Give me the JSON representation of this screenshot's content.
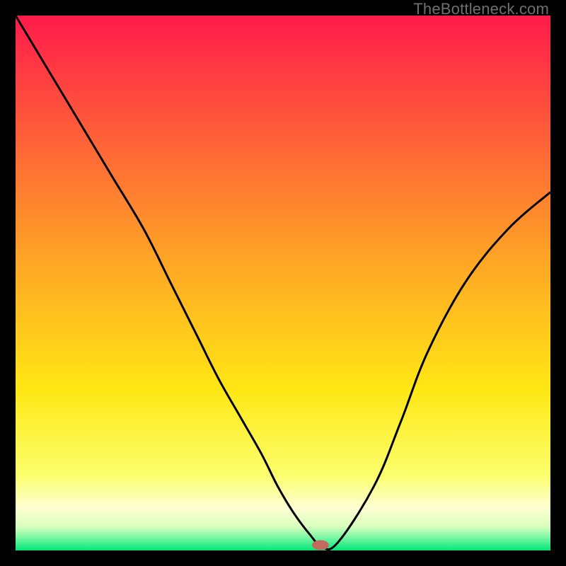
{
  "watermark": "TheBottleneck.com",
  "chart_data": {
    "type": "line",
    "title": "",
    "xlabel": "",
    "ylabel": "",
    "xlim": [
      0,
      100
    ],
    "ylim": [
      0,
      100
    ],
    "grid": false,
    "background_gradient": {
      "stops": [
        {
          "offset": 0.0,
          "color": "#ff1b4b"
        },
        {
          "offset": 0.45,
          "color": "#ffa326"
        },
        {
          "offset": 0.7,
          "color": "#ffe714"
        },
        {
          "offset": 0.86,
          "color": "#fbff6d"
        },
        {
          "offset": 0.92,
          "color": "#feffd2"
        },
        {
          "offset": 0.955,
          "color": "#d9ffbe"
        },
        {
          "offset": 0.975,
          "color": "#7ef7a5"
        },
        {
          "offset": 1.0,
          "color": "#00e778"
        }
      ]
    },
    "series": [
      {
        "name": "bottleneck-curve",
        "color": "#000000",
        "x": [
          0,
          6,
          12,
          18,
          24,
          29,
          34,
          38,
          42,
          46,
          49,
          52,
          55,
          57,
          60,
          67,
          72,
          77,
          84,
          92,
          100
        ],
        "y": [
          100,
          90,
          80,
          70,
          60,
          50,
          40,
          32,
          25,
          18,
          12,
          7,
          3,
          1,
          1.2,
          12,
          24,
          37,
          50,
          60,
          67
        ]
      }
    ],
    "marker": {
      "name": "bottleneck-marker",
      "x": 57,
      "y": 1,
      "color": "#c46a5d",
      "rx": 12,
      "ry": 7
    }
  }
}
